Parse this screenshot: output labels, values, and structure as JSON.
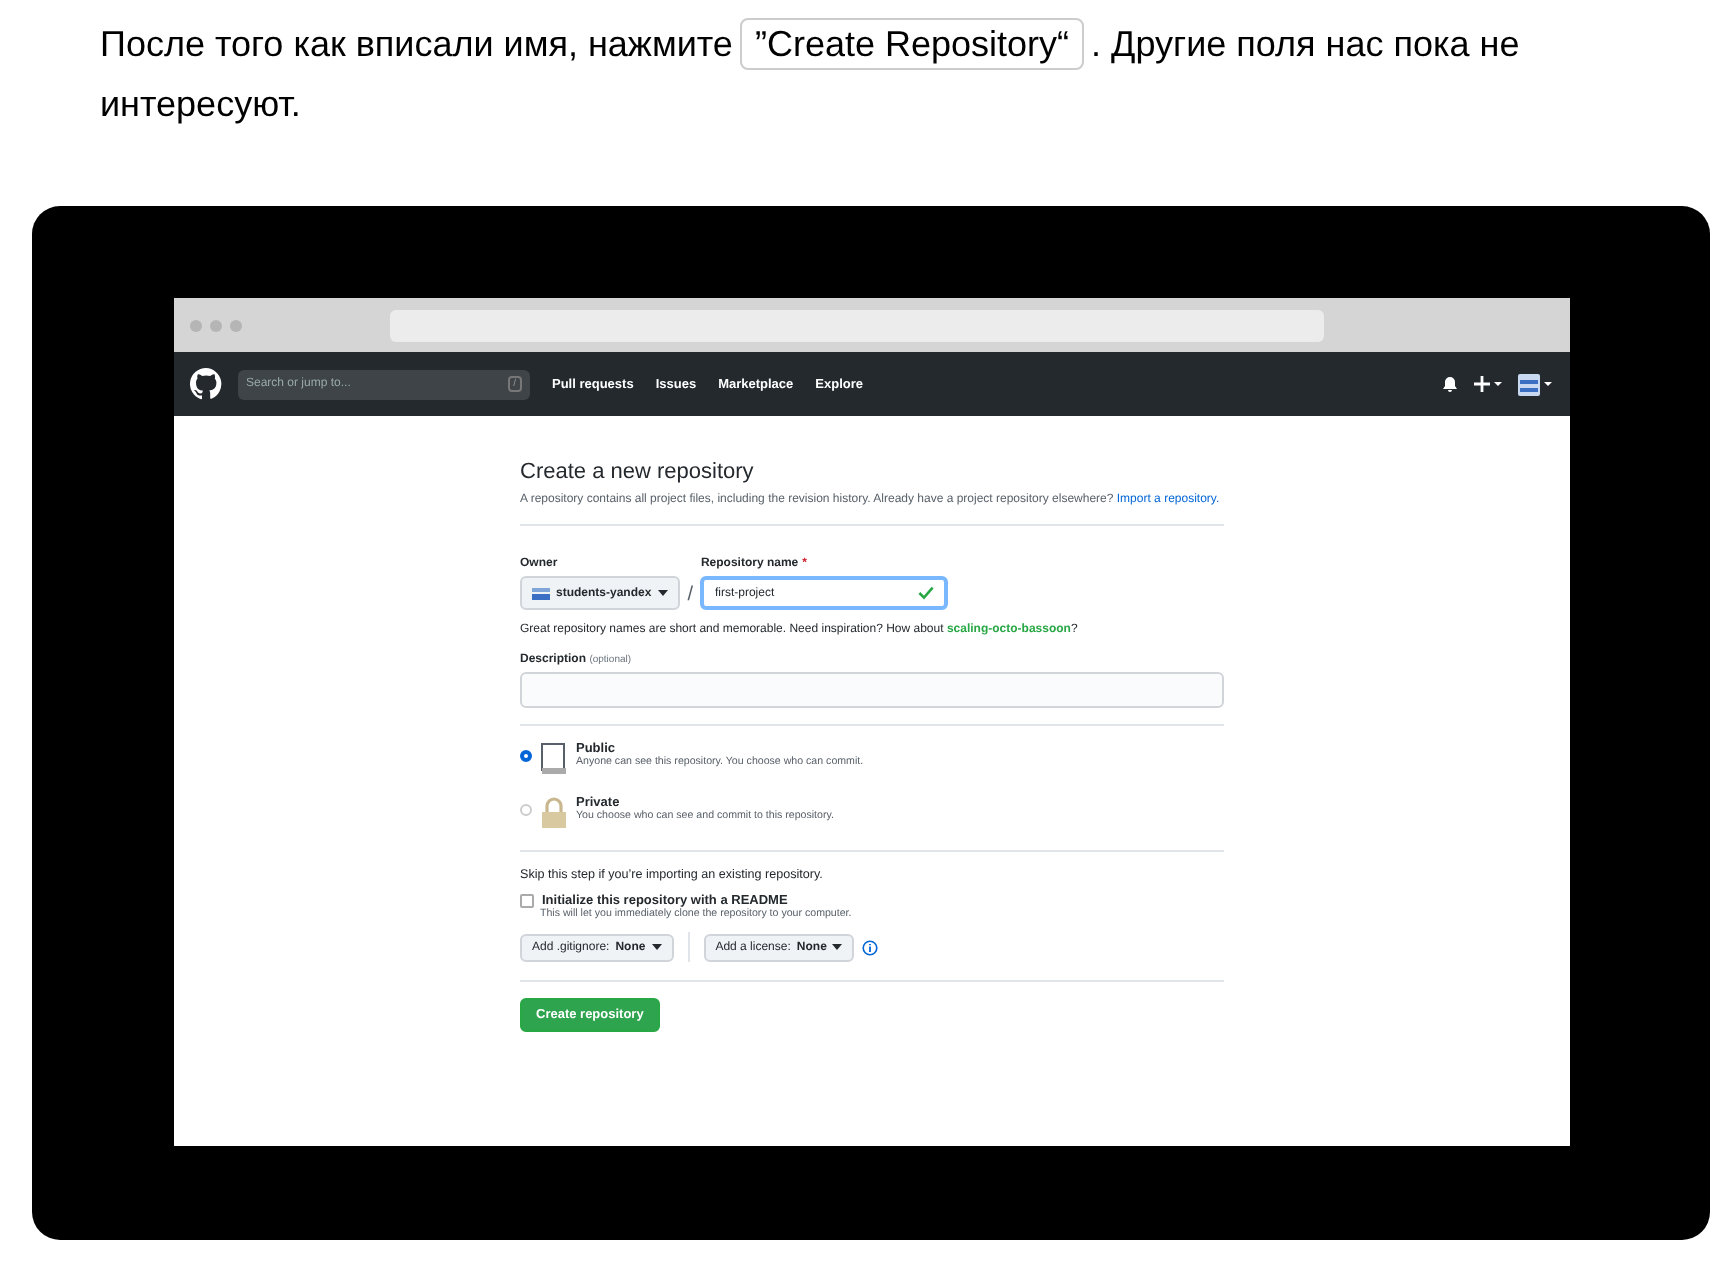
{
  "intro": {
    "before": "После того как вписали имя, нажмите",
    "code": "”Create Repository“",
    "after": ". Другие поля нас пока не интересуют."
  },
  "nav": {
    "search_placeholder": "Search or jump to...",
    "search_key": "/",
    "links": [
      "Pull requests",
      "Issues",
      "Marketplace",
      "Explore"
    ]
  },
  "form": {
    "title": "Create a new repository",
    "description": "A repository contains all project files, including the revision history. Already have a project repository elsewhere?",
    "import_link": "Import a repository.",
    "owner_label": "Owner",
    "owner_value": "students-yandex",
    "separator": "/",
    "name_label": "Repository name",
    "required_mark": "*",
    "name_value": "first-project",
    "name_valid": true,
    "hint": "Great repository names are short and memorable. Need inspiration? How about",
    "suggestion": "scaling-octo-bassoon",
    "hint_end": "?",
    "description_label": "Description",
    "optional": "(optional)",
    "visibility": [
      {
        "kind": "public",
        "title": "Public",
        "text": "Anyone can see this repository. You choose who can commit.",
        "selected": true
      },
      {
        "kind": "private",
        "title": "Private",
        "text": "You choose who can see and commit to this repository.",
        "selected": false
      }
    ],
    "skip_text": "Skip this step if you’re importing an existing repository.",
    "readme": {
      "label": "Initialize this repository with a README",
      "text": "This will let you immediately clone the repository to your computer.",
      "checked": false
    },
    "gitignore": {
      "label": "Add .gitignore:",
      "value": "None"
    },
    "license": {
      "label": "Add a license:",
      "value": "None"
    },
    "submit": "Create repository"
  }
}
